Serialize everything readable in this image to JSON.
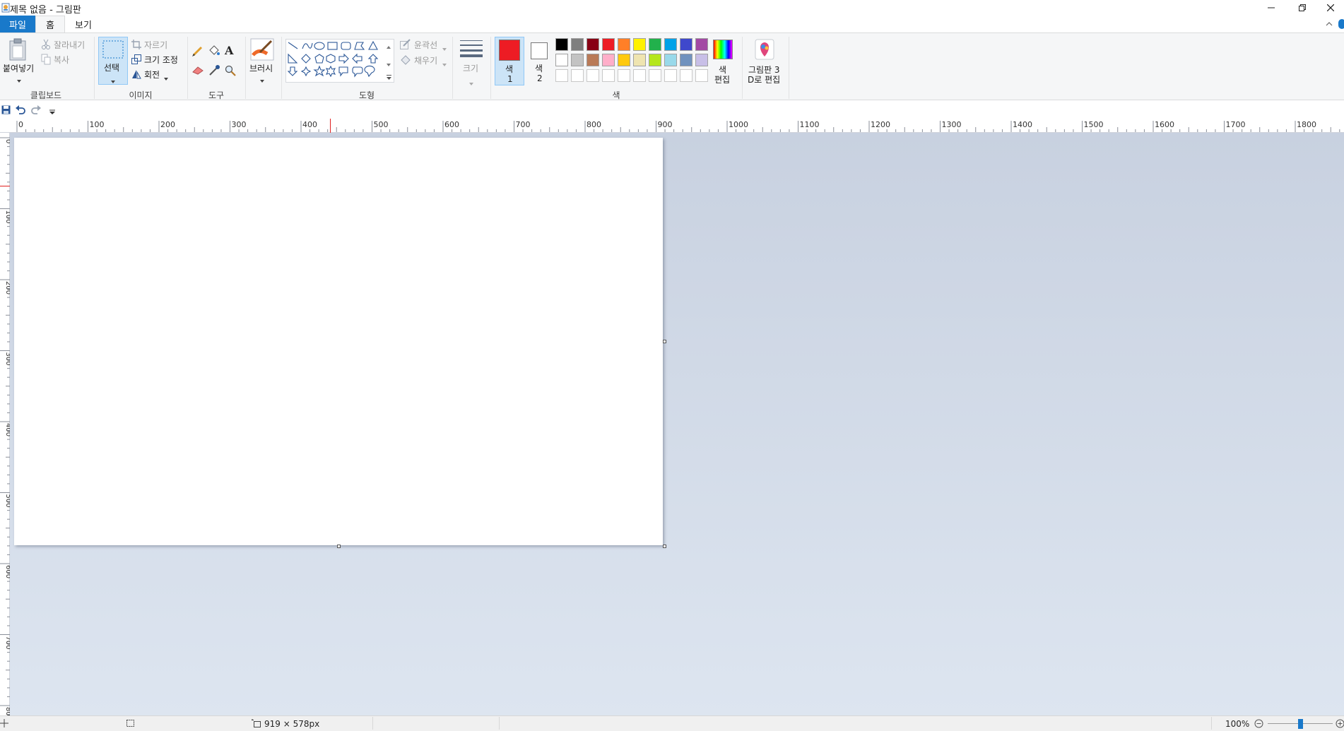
{
  "window": {
    "title": "제목 없음 - 그림판"
  },
  "tabs": {
    "file": "파일",
    "home": "홈",
    "view": "보기"
  },
  "clipboard": {
    "paste": "붙여넣기",
    "cut": "잘라내기",
    "copy": "복사",
    "group": "클립보드"
  },
  "image": {
    "select": "선택",
    "crop": "자르기",
    "resize": "크기 조정",
    "rotate": "회전",
    "group": "이미지"
  },
  "tools": {
    "group": "도구",
    "text_glyph": "A"
  },
  "brushes": {
    "label": "브러시"
  },
  "shapes": {
    "outline": "윤곽선",
    "fill": "채우기",
    "group": "도형"
  },
  "size": {
    "label": "크기"
  },
  "colors": {
    "color1_label": "색",
    "color1_num": "1",
    "color2_label": "색",
    "color2_num": "2",
    "color1_value": "#ed1c24",
    "color2_value": "#ffffff",
    "edit_line1": "색",
    "edit_line2": "편집",
    "group": "색",
    "palette_row1": [
      "#000000",
      "#7f7f7f",
      "#880015",
      "#ed1c24",
      "#ff7f27",
      "#fff200",
      "#22b14c",
      "#00a2e8",
      "#3f48cc",
      "#a349a4"
    ],
    "palette_row2": [
      "#ffffff",
      "#c3c3c3",
      "#b97a57",
      "#ffaec9",
      "#ffc90e",
      "#efe4b0",
      "#b5e61d",
      "#99d9ea",
      "#7092be",
      "#c8bfe7"
    ]
  },
  "paint3d": {
    "line1": "그림판 3",
    "line2": "D로 편집"
  },
  "ruler": {
    "h_labels": [
      "0",
      "100",
      "200",
      "300",
      "400",
      "500",
      "600",
      "700",
      "800",
      "900",
      "1000",
      "1100",
      "1200",
      "1300",
      "1400",
      "1500",
      "1600",
      "1700",
      "1800"
    ],
    "v_labels": [
      "0",
      "100",
      "200",
      "300",
      "400",
      "500",
      "600",
      "700",
      "800"
    ]
  },
  "status": {
    "dimensions": "919 × 578px",
    "zoom": "100%",
    "zoom_level": 100
  }
}
